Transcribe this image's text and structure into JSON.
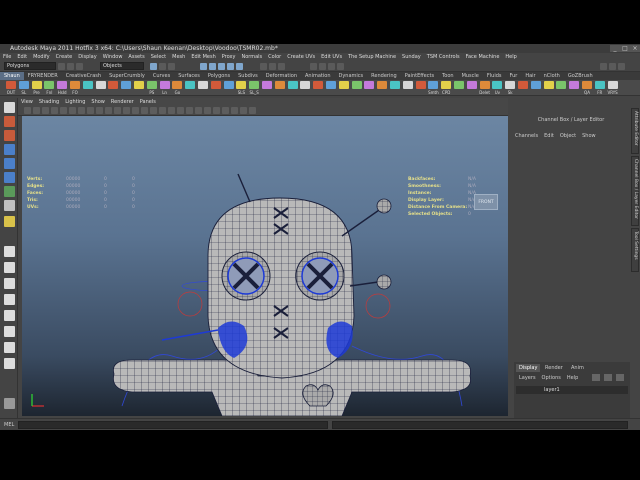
{
  "window": {
    "title": "Autodesk Maya 2011 Hotfix 3 x64: C:\\Users\\Shaun Keenan\\Desktop\\Voodoo\\TSMR02.mb*",
    "controls": [
      "_",
      "□",
      "×"
    ]
  },
  "menubar": [
    "File",
    "Edit",
    "Modify",
    "Create",
    "Display",
    "Window",
    "Assets",
    "Select",
    "Mesh",
    "Edit Mesh",
    "Proxy",
    "Normals",
    "Color",
    "Create UVs",
    "Edit UVs",
    "The Setup Machine",
    "Sunday",
    "TSM Controls",
    "Face Machine",
    "Help"
  ],
  "statusline": {
    "mode": "Polygons",
    "selection_field": "Objects"
  },
  "shelf": {
    "tabs": [
      "Shaun",
      "FRYRENDER",
      "CreativeCrash",
      "SuperCrumbly",
      "Curves",
      "Surfaces",
      "Polygons",
      "Subdivs",
      "Deformation",
      "Animation",
      "Dynamics",
      "Rendering",
      "PaintEffects",
      "Toon",
      "Muscle",
      "Fluids",
      "Fur",
      "Hair",
      "nCloth",
      "GoZBrush"
    ],
    "active_tab": "Shaun",
    "buttons": [
      "OUT",
      "SL",
      "Pre",
      "FnI",
      "HsId",
      "FO",
      "",
      "",
      "",
      "",
      "",
      "PS",
      "Ln",
      "Go",
      "",
      "",
      "",
      "",
      "SLS",
      "SL_S",
      "",
      "",
      "",
      "",
      "",
      "",
      "",
      "",
      "",
      "",
      "",
      "",
      "",
      "Smth",
      "CPD",
      "",
      "",
      "Delet",
      "Uv",
      "Sk",
      "",
      "",
      "",
      "",
      "",
      "QA",
      "FR",
      "VRYS"
    ]
  },
  "viewport": {
    "menu": [
      "View",
      "Shading",
      "Lighting",
      "Show",
      "Renderer",
      "Panels"
    ],
    "hud_left": [
      {
        "label": "Verts:",
        "v1": "00000",
        "v2": "0",
        "v3": "0"
      },
      {
        "label": "Edges:",
        "v1": "00000",
        "v2": "0",
        "v3": "0"
      },
      {
        "label": "Faces:",
        "v1": "00000",
        "v2": "0",
        "v3": "0"
      },
      {
        "label": "Tris:",
        "v1": "00000",
        "v2": "0",
        "v3": "0"
      },
      {
        "label": "UVs:",
        "v1": "00000",
        "v2": "0",
        "v3": "0"
      }
    ],
    "hud_right": [
      {
        "label": "Backfaces:",
        "value": "N/A"
      },
      {
        "label": "Smoothness:",
        "value": "N/A"
      },
      {
        "label": "Instance:",
        "value": "N/A"
      },
      {
        "label": "Display Layer:",
        "value": "N/A"
      },
      {
        "label": "Distance From Camera:",
        "value": "N/A"
      },
      {
        "label": "Selected Objects:",
        "value": "0"
      }
    ],
    "front_button": "FRONT"
  },
  "channel_box": {
    "title": "Channel Box / Layer Editor",
    "menu": [
      "Channels",
      "Edit",
      "Object",
      "Show"
    ]
  },
  "layer_editor": {
    "tabs": [
      "Display",
      "Render",
      "Anim"
    ],
    "active_tab": "Display",
    "menu": [
      "Layers",
      "Options",
      "Help"
    ],
    "layers": [
      {
        "name": "layer1"
      }
    ]
  },
  "side_tabs": [
    "Attribute Editor",
    "Channel Box / Layer Editor",
    "Tool Settings"
  ],
  "command_line": {
    "label": "MEL"
  },
  "colors": {
    "accent": "#5b6e86",
    "mesh_wire": "#1a1f3a",
    "mesh_face": "#b7b7b7",
    "selection_blue": "#1d3ad6",
    "hud_label": "#e6e08a",
    "curve_red": "#c23a3a"
  }
}
